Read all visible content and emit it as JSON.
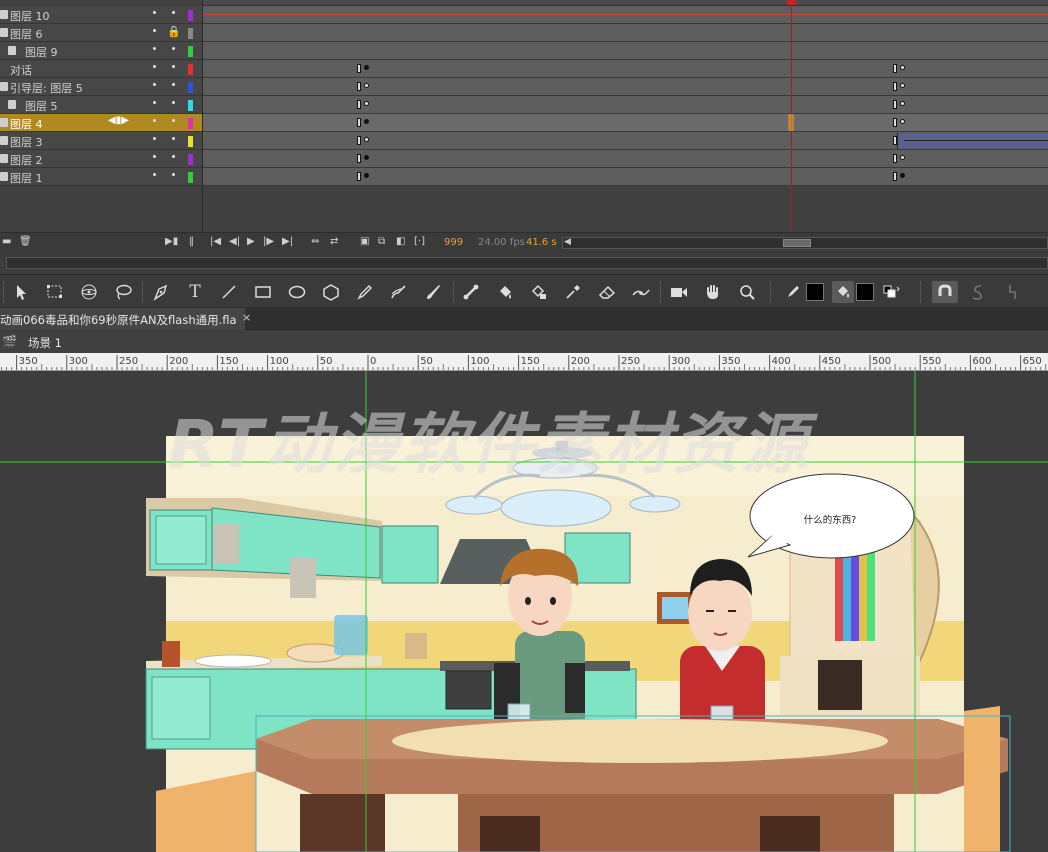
{
  "timeline": {
    "layers": [
      {
        "name": "图层 10",
        "color": "#9b30d0",
        "indent": 0,
        "locked": false,
        "selected": false,
        "icon": "layer-icon"
      },
      {
        "name": "图层 6",
        "color": "#888888",
        "indent": 0,
        "locked": true,
        "selected": false,
        "icon": "layer-icon"
      },
      {
        "name": "图层 9",
        "color": "#2fd040",
        "indent": 1,
        "locked": false,
        "selected": false,
        "icon": "masked-layer-icon"
      },
      {
        "name": "对话",
        "color": "#e03030",
        "indent": 0,
        "locked": false,
        "selected": false,
        "icon": "none"
      },
      {
        "name": "引导层: 图层 5",
        "color": "#3050e0",
        "indent": 0,
        "locked": false,
        "selected": false,
        "icon": "guide-layer-icon"
      },
      {
        "name": "图层 5",
        "color": "#30d8e8",
        "indent": 1,
        "locked": false,
        "selected": false,
        "icon": "guided-layer-icon"
      },
      {
        "name": "图层 4",
        "color": "#e030b0",
        "indent": 0,
        "locked": false,
        "selected": true,
        "icon": "layer-icon"
      },
      {
        "name": "图层 3",
        "color": "#e8e030",
        "indent": 0,
        "locked": false,
        "selected": false,
        "icon": "layer-icon"
      },
      {
        "name": "图层 2",
        "color": "#9b30d0",
        "indent": 0,
        "locked": false,
        "selected": false,
        "icon": "layer-icon"
      },
      {
        "name": "图层 1",
        "color": "#2fd040",
        "indent": 0,
        "locked": false,
        "selected": false,
        "icon": "layer-icon"
      }
    ],
    "controls": {
      "current_frame": "999",
      "fps": "24.00 fps",
      "seconds": "41.6 s"
    }
  },
  "toolbar": {
    "tools": [
      "selection-tool",
      "free-transform-tool",
      "3d-rotation-tool",
      "lasso-tool",
      "pen-tool",
      "text-tool",
      "line-tool",
      "rectangle-tool",
      "oval-tool",
      "polystar-tool",
      "pencil-tool",
      "paint-brush-tool",
      "brush-tool",
      "bone-tool",
      "paint-bucket-tool",
      "ink-bottle-tool",
      "eyedropper-tool",
      "eraser-tool",
      "width-tool",
      "camera-tool",
      "hand-tool",
      "zoom-tool",
      "stroke-color-tool",
      "fill-color-tool",
      "swap-colors-tool",
      "snap-to-objects-tool",
      "smooth-tool",
      "straighten-tool"
    ],
    "text_tool_glyph": "T"
  },
  "document": {
    "tab_title": "动画066毒品和你69秒原件AN及flash通用.fla",
    "close": "×",
    "scene_label": "场景 1"
  },
  "ruler": {
    "labels": [
      "350",
      "300",
      "250",
      "200",
      "150",
      "100",
      "50",
      "0",
      "50",
      "100",
      "150",
      "200",
      "250",
      "300",
      "350",
      "400",
      "450",
      "500",
      "550",
      "600",
      "650"
    ]
  },
  "stage": {
    "watermark": "RT动漫软件素材资源",
    "speech_bubble": "什么的东西?"
  }
}
